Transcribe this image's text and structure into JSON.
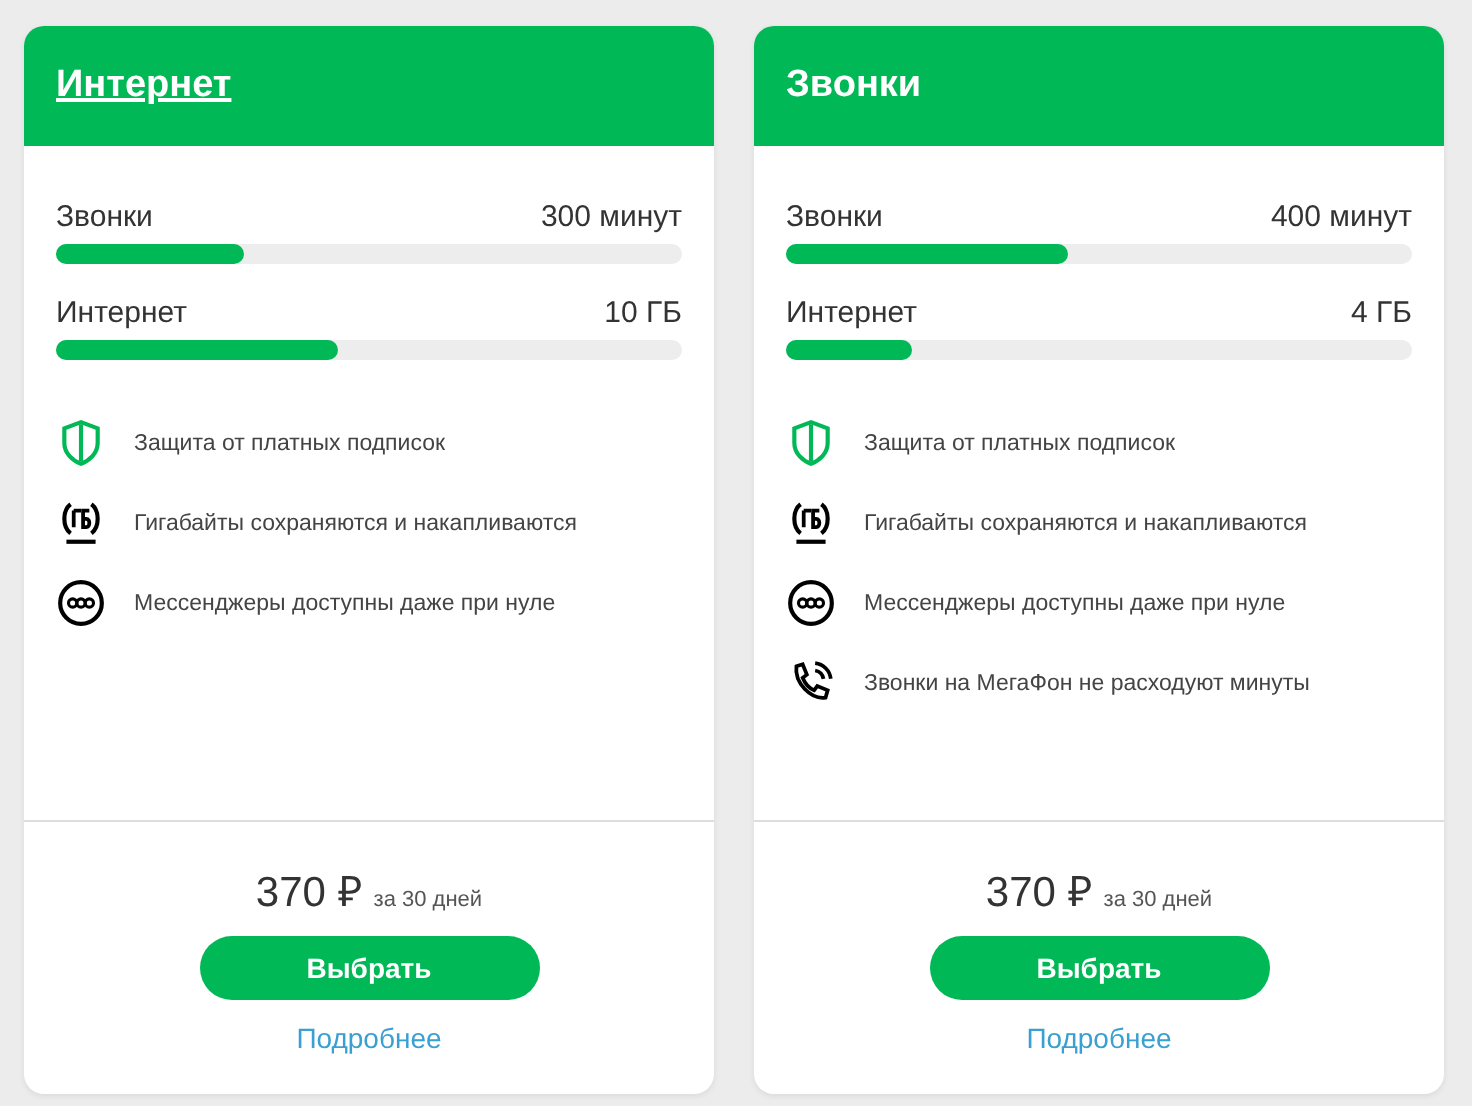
{
  "tariffs": [
    {
      "title": "Интернет",
      "title_underlined": true,
      "allowances": [
        {
          "label": "Звонки",
          "amount": "300 минут",
          "level": 0.3
        },
        {
          "label": "Интернет",
          "amount": "10 ГБ",
          "level": 0.45
        }
      ],
      "features": [
        {
          "kind": "shield",
          "text": "Защита от платных подписок"
        },
        {
          "kind": "gb",
          "text": "Гигабайты сохраняются и накапливаются"
        },
        {
          "kind": "sos",
          "text": "Мессенджеры доступны даже при нуле"
        }
      ],
      "price": "370 ₽",
      "period": "за 30 дней",
      "button": "Выбрать",
      "link": "Подробнее"
    },
    {
      "title": "Звонки",
      "title_underlined": false,
      "allowances": [
        {
          "label": "Звонки",
          "amount": "400 минут",
          "level": 0.45
        },
        {
          "label": "Интернет",
          "amount": "4 ГБ",
          "level": 0.2
        }
      ],
      "features": [
        {
          "kind": "shield",
          "text": "Защита от платных подписок"
        },
        {
          "kind": "gb",
          "text": "Гигабайты сохраняются и накапливаются"
        },
        {
          "kind": "sos",
          "text": "Мессенджеры доступны даже при нуле"
        },
        {
          "kind": "phone",
          "text": "Звонки на МегаФон не расходуют минуты"
        }
      ],
      "price": "370 ₽",
      "period": "за 30 дней",
      "button": "Выбрать",
      "link": "Подробнее"
    }
  ]
}
